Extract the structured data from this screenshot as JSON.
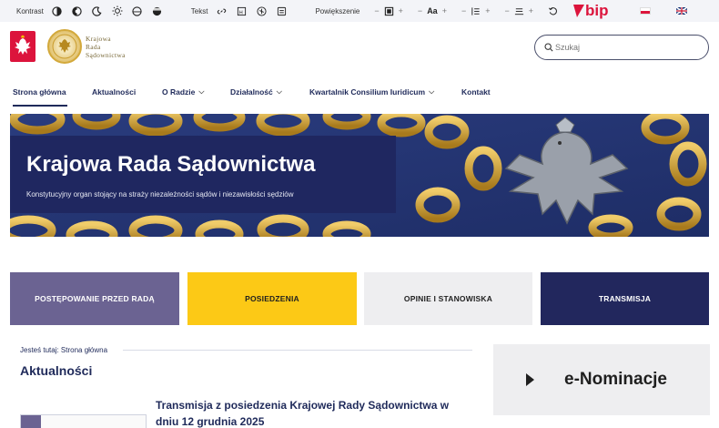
{
  "accessibility": {
    "contrast_label": "Kontrast",
    "text_label": "Tekst",
    "zoom_label": "Powiększenie",
    "font_size_label": "Aa",
    "minus": "−",
    "plus": "+",
    "bip_label": "bip"
  },
  "header": {
    "logo_lines": [
      "Krajowa",
      "Rada",
      "Sądownictwa"
    ],
    "search_placeholder": "Szukaj"
  },
  "nav": {
    "items": [
      {
        "label": "Strona główna",
        "active": true,
        "dropdown": false
      },
      {
        "label": "Aktualności",
        "dropdown": false
      },
      {
        "label": "O Radzie",
        "dropdown": true
      },
      {
        "label": "Działalność",
        "dropdown": true
      },
      {
        "label": "Kwartalnik Consilium Iuridicum",
        "dropdown": true
      },
      {
        "label": "Kontakt",
        "dropdown": false
      }
    ],
    "chevron": "⌵"
  },
  "hero": {
    "title": "Krajowa Rada Sądownictwa",
    "subtitle": "Konstytucyjny organ stojący na straży niezależności sądów i niezawisłości sędziów"
  },
  "tiles": [
    {
      "label": "POSTĘPOWANIE PRZED RADĄ"
    },
    {
      "label": "POSIEDZENIA"
    },
    {
      "label": "OPINIE I STANOWISKA"
    },
    {
      "label": "TRANSMISJA"
    }
  ],
  "breadcrumb": "Jesteś tutaj: Strona główna",
  "news": {
    "heading": "Aktualności",
    "first_title": "Transmisja z posiedzenia Krajowej Rady Sądownictwa w dniu 12 grudnia 2025"
  },
  "sidebar": {
    "enominacje": "e-Nominacje"
  },
  "colors": {
    "navy": "#1f2a5a",
    "purple": "#6b6392",
    "yellow": "#fcc916",
    "bip_red": "#dc143c"
  }
}
